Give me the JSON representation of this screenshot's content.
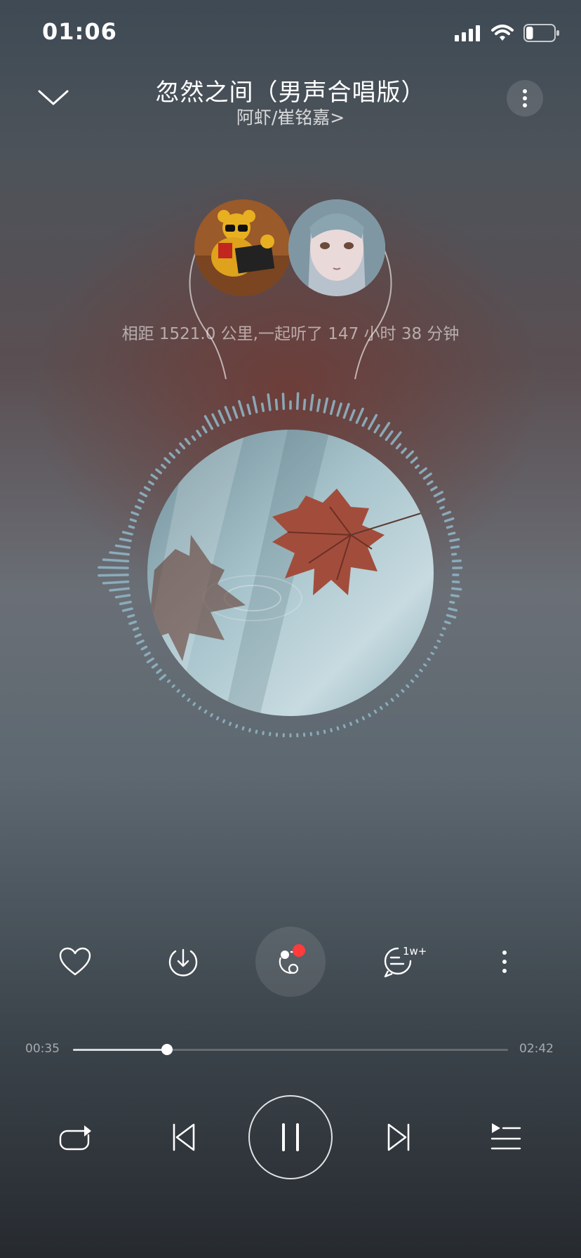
{
  "status_bar": {
    "time": "01:06",
    "signal_icon": "cellular-signal-icon",
    "wifi_icon": "wifi-icon",
    "battery_icon": "battery-icon",
    "battery_level": 0.25
  },
  "header": {
    "collapse_icon": "chevron-down-icon",
    "title": "忽然之间（男声合唱版）",
    "artist": "阿虾/崔铭嘉>",
    "more_icon": "more-vertical-icon"
  },
  "listen_together": {
    "avatar_left": "winnie-the-pooh-avatar",
    "avatar_right": "anime-girl-avatar",
    "text": "相距 1521.0 公里,一起听了 147 小时 38 分钟"
  },
  "album": {
    "art": "maple-leaf-on-water-artwork",
    "accent_color": "#8fb3c4"
  },
  "actions": {
    "like_icon": "heart-icon",
    "download_icon": "download-icon",
    "share_icon": "listen-together-icon",
    "share_badge_color": "#ff3b3b",
    "comment_icon": "comment-icon",
    "comment_count": "1w+",
    "more_icon": "more-vertical-icon"
  },
  "progress": {
    "current": "00:35",
    "total": "02:42",
    "fraction": 0.216
  },
  "controls": {
    "repeat_icon": "repeat-icon",
    "prev_icon": "skip-previous-icon",
    "play_pause_icon": "pause-icon",
    "next_icon": "skip-next-icon",
    "playlist_icon": "playlist-icon"
  }
}
